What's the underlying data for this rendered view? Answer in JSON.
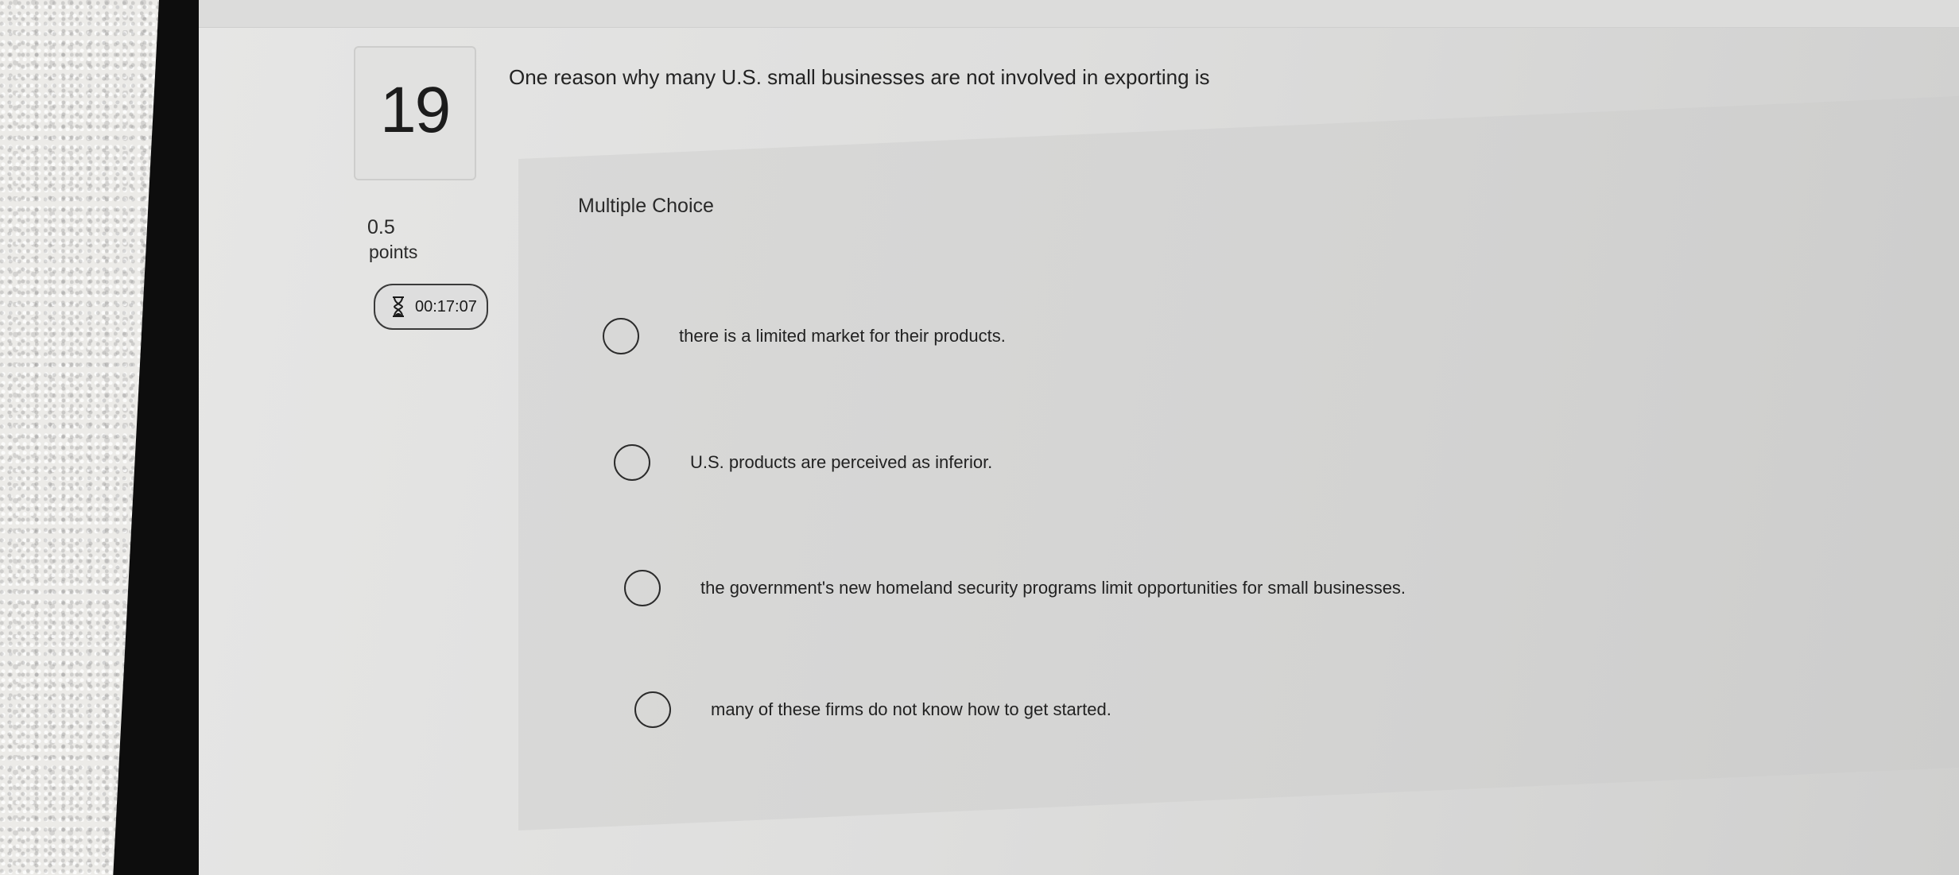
{
  "question": {
    "number": "19",
    "text": "One reason why many U.S. small businesses are not involved in exporting is",
    "points_value": "0.5",
    "points_label": "points",
    "timer": "00:17:07",
    "type_label": "Multiple Choice"
  },
  "options": [
    {
      "label": "there is a limited market for their products.",
      "selected": false
    },
    {
      "label": "U.S. products are perceived as inferior.",
      "selected": false
    },
    {
      "label": "the government's new homeland security programs limit opportunities for small businesses.",
      "selected": false
    },
    {
      "label": "many of these firms do not know how to get started.",
      "selected": false
    }
  ],
  "icons": {
    "timer": "hourglass-icon",
    "option": "radio-circle"
  },
  "colors": {
    "text": "#232323",
    "radio_border": "#2b2b2b",
    "background": "#dededd"
  }
}
